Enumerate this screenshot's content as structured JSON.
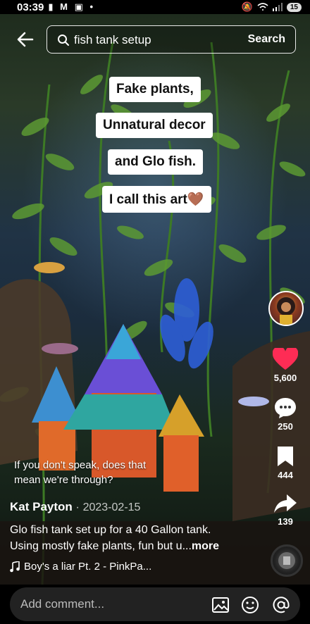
{
  "status_bar": {
    "time": "03:39",
    "left_icons": "▮ M ▣ •",
    "battery": "15"
  },
  "search": {
    "query": "fish tank setup",
    "button_label": "Search"
  },
  "captions": [
    "Fake plants,",
    "Unnatural decor",
    "and Glo fish.",
    "I call this art🤎"
  ],
  "actions": {
    "likes": "5,600",
    "comments": "250",
    "saves": "444",
    "shares": "139"
  },
  "subtitle": {
    "line1": "If you don't speak, does that",
    "line2": "mean we're through?"
  },
  "post": {
    "author": "Kat Payton",
    "separator": "·",
    "date": "2023-02-15",
    "description_line1": "Glo fish tank set up for a 40 Gallon tank.",
    "description_line2": "Using mostly fake plants, fun but u...",
    "more_label": "more",
    "music": "Boy's a liar Pt. 2 - PinkPa..."
  },
  "comment_bar": {
    "placeholder": "Add comment..."
  },
  "colors": {
    "like_red": "#fe2c55",
    "caption_bg": "#ffffff"
  }
}
